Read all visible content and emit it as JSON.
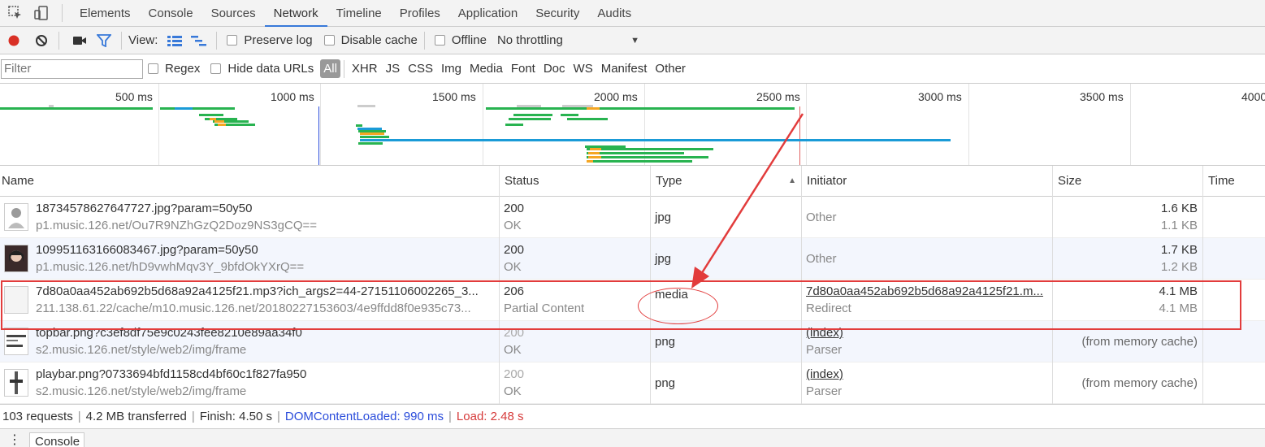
{
  "tabs": [
    "Elements",
    "Console",
    "Sources",
    "Network",
    "Timeline",
    "Profiles",
    "Application",
    "Security",
    "Audits"
  ],
  "active_tab": "Network",
  "toolbar": {
    "view_label": "View:",
    "preserve_log": "Preserve log",
    "disable_cache": "Disable cache",
    "offline": "Offline",
    "throttling": "No throttling"
  },
  "filter": {
    "placeholder": "Filter",
    "regex": "Regex",
    "hide_data_urls": "Hide data URLs",
    "types": [
      "All",
      "XHR",
      "JS",
      "CSS",
      "Img",
      "Media",
      "Font",
      "Doc",
      "WS",
      "Manifest",
      "Other"
    ]
  },
  "overview": {
    "ticks": [
      "500 ms",
      "1000 ms",
      "1500 ms",
      "2000 ms",
      "2500 ms",
      "3000 ms",
      "3500 ms",
      "4000"
    ]
  },
  "columns": {
    "name": "Name",
    "status": "Status",
    "type": "Type",
    "initiator": "Initiator",
    "size": "Size",
    "time": "Time"
  },
  "rows": [
    {
      "name": "18734578627647727.jpg?param=50y50",
      "host": "p1.music.126.net/Ou7R9NZhGzQ2Doz9NS3gCQ==",
      "status": "200",
      "status_text": "OK",
      "type": "jpg",
      "initiator": "Other",
      "initiator_sub": "",
      "size": "1.6 KB",
      "size_sub": "1.1 KB"
    },
    {
      "name": "109951163166083467.jpg?param=50y50",
      "host": "p1.music.126.net/hD9vwhMqv3Y_9bfdOkYXrQ==",
      "status": "200",
      "status_text": "OK",
      "type": "jpg",
      "initiator": "Other",
      "initiator_sub": "",
      "size": "1.7 KB",
      "size_sub": "1.2 KB"
    },
    {
      "name": "7d80a0aa452ab692b5d68a92a4125f21.mp3?ich_args2=44-27151106002265_3...",
      "host": "211.138.61.22/cache/m10.music.126.net/20180227153603/4e9ffdd8f0e935c73...",
      "status": "206",
      "status_text": "Partial Content",
      "type": "media",
      "initiator": "7d80a0aa452ab692b5d68a92a4125f21.m...",
      "initiator_sub": "Redirect",
      "size": "4.1 MB",
      "size_sub": "4.1 MB"
    },
    {
      "name": "topbar.png?c3ef8df75e9c0243fee8210e89aa34f0",
      "host": "s2.music.126.net/style/web2/img/frame",
      "status": "200",
      "status_text": "OK",
      "type": "png",
      "initiator": "(index)",
      "initiator_sub": "Parser",
      "size": "(from memory cache)",
      "size_sub": ""
    },
    {
      "name": "playbar.png?0733694bfd1158cd4bf60c1f827fa950",
      "host": "s2.music.126.net/style/web2/img/frame",
      "status": "200",
      "status_text": "OK",
      "type": "png",
      "initiator": "(index)",
      "initiator_sub": "Parser",
      "size": "(from memory cache)",
      "size_sub": ""
    }
  ],
  "status_bar": {
    "requests": "103 requests",
    "transferred": "4.2 MB transferred",
    "finish": "Finish: 4.50 s",
    "dom_content_loaded": "DOMContentLoaded: 990 ms",
    "load": "Load: 2.48 s"
  },
  "drawer": {
    "tab": "Console"
  },
  "colors": {
    "accent": "#3879d9",
    "record_red": "#d93025",
    "annotation_red": "#e23c3c",
    "dcl_blue": "#2a4cdb",
    "load_red": "#d63a3a",
    "bar_green": "#28b350",
    "bar_blue": "#1a9bd7",
    "bar_orange": "#f5a623"
  }
}
